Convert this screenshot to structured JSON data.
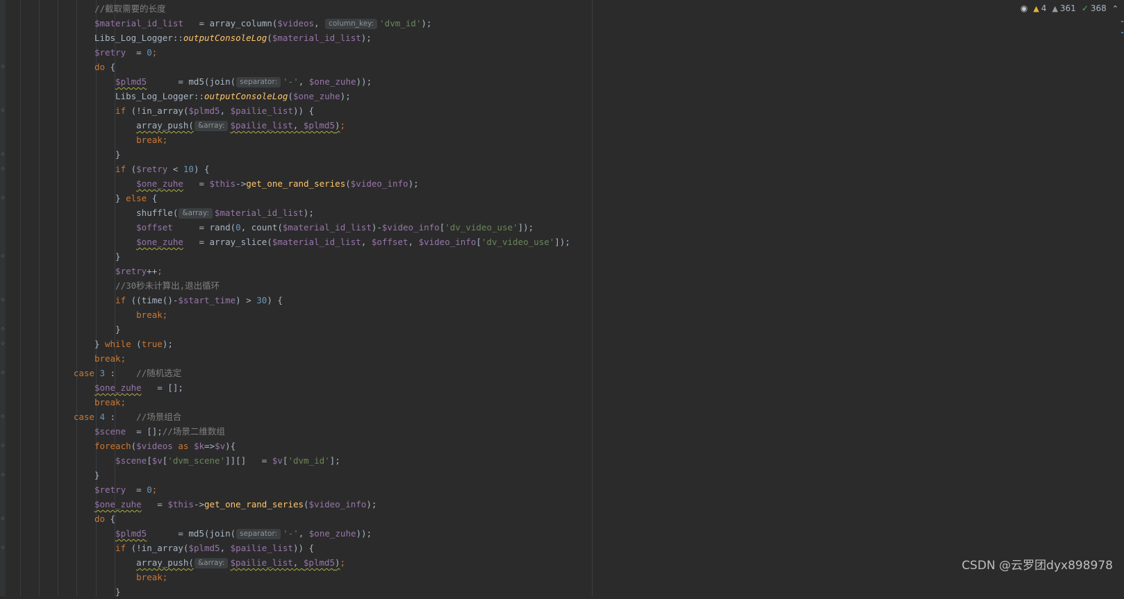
{
  "status": {
    "warnings_yellow": "4",
    "warnings_gray": "361",
    "ok_count": "368"
  },
  "watermark": "CSDN @云罗团dyx898978",
  "code": {
    "l1_comment": "//截取需要的长度",
    "hint_column_key": "column_key:",
    "hint_separator": "separator:",
    "hint_array": "&array:",
    "case3_comment": "//随机选定",
    "case4_comment": "//场景组合",
    "scene_comment": "//场景二维数组",
    "timeout_comment": "//30秒未计算出,退出循环"
  }
}
